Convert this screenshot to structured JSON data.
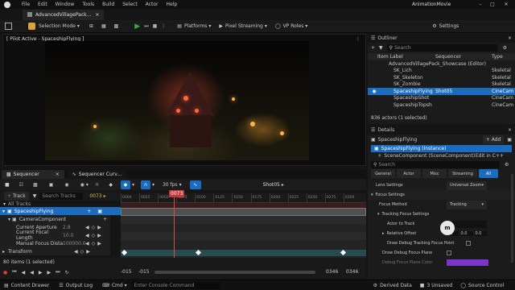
{
  "titlebar": {
    "project_tab": "AdvancedVillagePack...",
    "app_title": "AnimationMovie"
  },
  "menu": [
    "File",
    "Edit",
    "Window",
    "Tools",
    "Build",
    "Select",
    "Actor",
    "Help"
  ],
  "toolbar": {
    "selection_mode": "Selection Mode",
    "platforms": "Platforms",
    "pixel_streaming": "Pixel Streaming",
    "vp_roles": "VP Roles",
    "settings": "Settings"
  },
  "viewport": {
    "pilot_label": "[ Pilot Active - SpaceshipFlying ]"
  },
  "sequencer": {
    "tab_label": "Sequencer",
    "tab2_label": "Sequencer Curv...",
    "fps": "30 fps",
    "shot_label": "Shot05",
    "track_button": "Track",
    "search_placeholder": "Search Tracks",
    "current_frame": "0073",
    "playhead_frame": "0073",
    "ruler_ticks": [
      "0000",
      "0025",
      "0050",
      "0075",
      "0100",
      "0125",
      "0150",
      "0175",
      "0200",
      "0225",
      "0250",
      "0275",
      "0300"
    ],
    "item_count_label": "All Tracks",
    "tracks": [
      {
        "name": "SpaceshipFlying",
        "value": ""
      },
      {
        "name": "CameraComponent",
        "value": ""
      },
      {
        "name": "Current Aperture",
        "value": "2.8"
      },
      {
        "name": "Current Focal Length",
        "value": "10.0"
      },
      {
        "name": "Manual Focus Distance",
        "value": "100000.0"
      },
      {
        "name": "Transform",
        "value": ""
      }
    ],
    "footer_count": "80 items (1 selected)",
    "footer_left_a": "-015",
    "footer_left_b": "-015",
    "footer_right_a": "0346",
    "footer_right_b": "0346"
  },
  "outliner": {
    "title": "Outliner",
    "search_placeholder": "Search",
    "columns": {
      "label": "Item Label",
      "sequencer": "Sequencer",
      "type": "Type"
    },
    "rows": [
      {
        "label": "AdvancedVillagePack_Showcase (Editor)",
        "sequencer": "",
        "type": "",
        "selected": false
      },
      {
        "label": "SK_Lich",
        "sequencer": "",
        "type": "Skeletal",
        "selected": false
      },
      {
        "label": "SK_Skeleton",
        "sequencer": "",
        "type": "Skeletal",
        "selected": false
      },
      {
        "label": "SK_Zombie",
        "sequencer": "",
        "type": "Skeletal",
        "selected": false
      },
      {
        "label": "SpaceshipFlying",
        "sequencer": "Shot05",
        "type": "CineCam",
        "selected": true
      },
      {
        "label": "SpaceshipShot",
        "sequencer": "",
        "type": "CineCam",
        "selected": false
      },
      {
        "label": "SpaceshipTopsh",
        "sequencer": "",
        "type": "CineCam",
        "selected": false
      }
    ],
    "count": "836 actors (1 selected)"
  },
  "details": {
    "title": "Details",
    "actor_name": "SpaceshipFlying",
    "add_button": "+ Add",
    "instance": "SpaceshipFlying (Instance)",
    "component": "SceneComponent (SceneComponent)",
    "edit_link": "Edit in C++",
    "search_placeholder": "Search",
    "filter_tabs": [
      "General",
      "Actor",
      "Misc",
      "Streaming",
      "All"
    ],
    "properties": [
      {
        "name": "Lens Settings",
        "value": "Universal Zoom"
      },
      {
        "name": "Focus Settings",
        "value": ""
      },
      {
        "name": "Focus Method",
        "value": "Tracking"
      },
      {
        "name": "Tracking Focus Settings",
        "value": ""
      },
      {
        "name": "Actor to Track",
        "value": ""
      },
      {
        "name": "Relative Offset",
        "value": "0.0"
      },
      {
        "name": "Draw Debug Tracking Focus Point",
        "value": ""
      },
      {
        "name": "Draw Debug Focus Plane",
        "value": ""
      },
      {
        "name": "Debug Focus Plane Color",
        "value": ""
      }
    ],
    "relative_offset_y": "0.0",
    "relative_offset_z": "0.0"
  },
  "statusbar": {
    "content_drawer": "Content Drawer",
    "output_log": "Output Log",
    "cmd": "Cmd",
    "console_placeholder": "Enter Console Command",
    "derived_data": "Derived Data",
    "unsaved": "3 Unsaved",
    "source_control": "Source Control"
  },
  "colors": {
    "accent": "#1b6cbf",
    "play": "#3fa745",
    "focus_plane": "#7b35c8"
  }
}
